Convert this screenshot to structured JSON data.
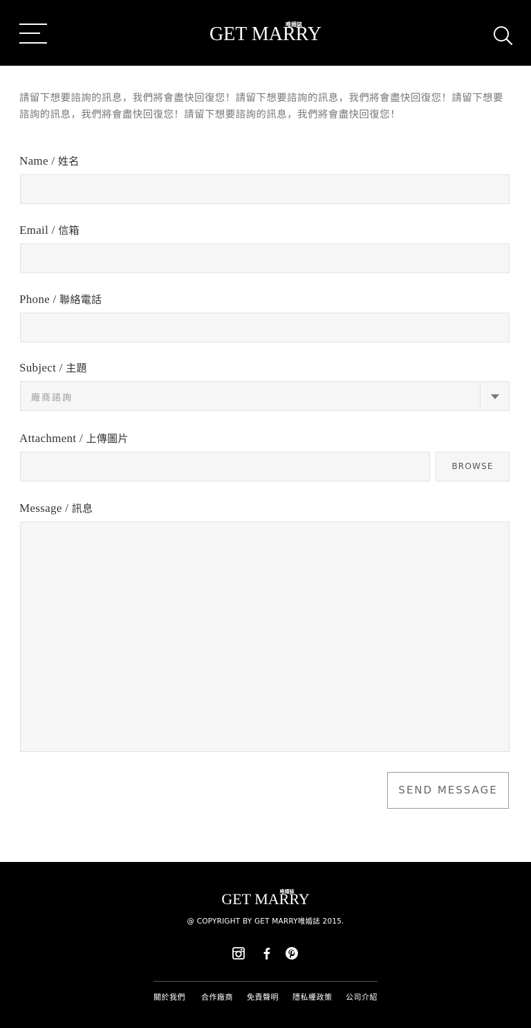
{
  "header": {
    "logo_main": "GET MARRY",
    "logo_sub": "唯婚誌"
  },
  "intro_text": "請留下想要諮詢的訊息，我們將會盡快回復您！請留下想要諮詢的訊息，我們將會盡快回復您！請留下想要諮詢的訊息，我們將會盡快回復您！請留下想要諮詢的訊息，我們將會盡快回復您！",
  "form": {
    "name_label_en": "Name / ",
    "name_label_zh": "姓名",
    "email_label_en": "Email / ",
    "email_label_zh": "信箱",
    "phone_label_en": "Phone / ",
    "phone_label_zh": "聯絡電話",
    "subject_label_en": "Subject / ",
    "subject_label_zh": "主題",
    "subject_value": "廠商諮詢",
    "attachment_label_en": "Attachment / ",
    "attachment_label_zh": "上傳圖片",
    "browse_label": "BROWSE",
    "message_label_en": "Message / ",
    "message_label_zh": "訊息",
    "send_label": "SEND MESSAGE"
  },
  "footer": {
    "logo_main": "GET MARRY",
    "logo_sub": "唯婚誌",
    "copyright": "@ COPYRIGHT BY GET MARRY唯婚誌 2015.",
    "social_icons": [
      "instagram-icon",
      "facebook-icon",
      "pinterest-icon"
    ],
    "links": [
      "關於我們",
      "合作廠商",
      "免責聲明",
      "隱私權政策",
      "公司介紹"
    ]
  },
  "colors": {
    "header_bg": "#000000",
    "field_bg": "#f6f6f6",
    "field_border": "#e2e2e2"
  }
}
